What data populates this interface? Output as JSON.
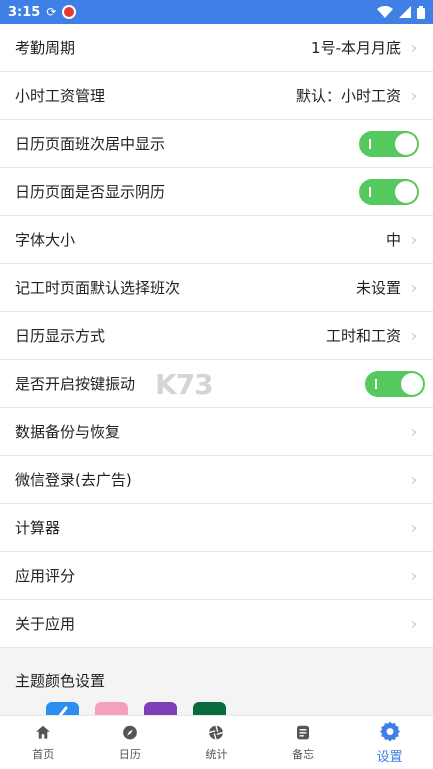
{
  "status_bar": {
    "time": "3:15",
    "sync_icon": "sync-icon",
    "badge_icon": "red-app-badge-icon"
  },
  "settings": [
    {
      "label": "考勤周期",
      "value": "1号-本月月底",
      "type": "chevron"
    },
    {
      "label": "小时工资管理",
      "value": "默认：小时工资",
      "type": "chevron"
    },
    {
      "label": "日历页面班次居中显示",
      "type": "toggle",
      "on": true
    },
    {
      "label": "日历页面是否显示阴历",
      "type": "toggle",
      "on": true
    },
    {
      "label": "字体大小",
      "value": "中",
      "type": "chevron"
    },
    {
      "label": "记工时页面默认选择班次",
      "value": "未设置",
      "type": "chevron"
    },
    {
      "label": "日历显示方式",
      "value": "工时和工资",
      "type": "chevron"
    },
    {
      "label": "是否开启按键振动",
      "type": "toggle",
      "on": true
    },
    {
      "label": "数据备份与恢复",
      "type": "chevron"
    },
    {
      "label": "微信登录(去广告)",
      "type": "chevron"
    },
    {
      "label": "计算器",
      "type": "chevron"
    },
    {
      "label": "应用评分",
      "type": "chevron"
    },
    {
      "label": "关于应用",
      "type": "chevron"
    }
  ],
  "theme": {
    "title": "主题颜色设置",
    "swatches": [
      "#2b8ef0",
      "#f5a0bd",
      "#7e3fb8",
      "#0a6b3a"
    ]
  },
  "nav": [
    {
      "label": "首页",
      "icon": "home-icon",
      "active": false
    },
    {
      "label": "日历",
      "icon": "compass-icon",
      "active": false
    },
    {
      "label": "统计",
      "icon": "aperture-icon",
      "active": false
    },
    {
      "label": "备忘",
      "icon": "memo-icon",
      "active": false
    },
    {
      "label": "设置",
      "icon": "gear-icon",
      "active": true
    }
  ],
  "watermark": "K73",
  "colors": {
    "accent": "#3f7fe6",
    "toggle_on": "#55c95d"
  }
}
